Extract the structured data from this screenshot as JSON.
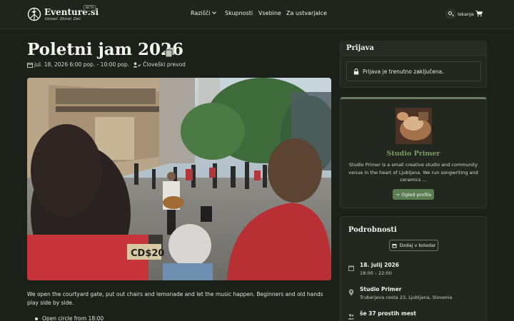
{
  "header": {
    "brand": "Eventure.si",
    "tagline": "Ustvari. Zbirali. Deli.",
    "beta": "BETA",
    "nav": [
      {
        "label": "Razišči"
      },
      {
        "label": "Skupnosti"
      },
      {
        "label": "Vsebine"
      },
      {
        "label": "Za ustvarjalce"
      }
    ],
    "search_label": "Iskanje",
    "icons": {
      "logo": "peace-dove-logo",
      "search": "search-icon",
      "cart": "cart-icon"
    }
  },
  "event": {
    "title": "Poletni jam 2026",
    "datetime": "jul. 18, 2026 6:00 pop. - 10:00 pop.",
    "interpretation": "Človeški prevod",
    "description": "We open the courtyard gate, put out chairs and lemonade and let the music happen. Beginners and old hands play side by side.",
    "bullets": [
      "Open circle from 18:00"
    ],
    "photo_sign": "CD$20"
  },
  "sidebar": {
    "registration": {
      "heading": "Prijava",
      "status": "Prijava je trenutno zaključena."
    },
    "organizer": {
      "name": "Studio Primer",
      "description": "Studio Primer is a small creative studio and community venue in the heart of Ljubljana. We run songwriting and ceramics ...",
      "profile_button": "Ogled profila"
    },
    "details": {
      "heading": "Podrobnosti",
      "calendar_button": "Dodaj v koledar",
      "date": "18. julij 2026",
      "time": "18:00 – 22:00",
      "venue": "Studio Primer",
      "address": "Trubarjeva cesta 23, Ljubljana, Slovenia",
      "capacity": "še 37 prostih mest"
    }
  },
  "colors": {
    "background": "#1b2019",
    "card": "#22281f",
    "accent_green": "#5b7e50",
    "organizer_name": "#7e9a63"
  }
}
